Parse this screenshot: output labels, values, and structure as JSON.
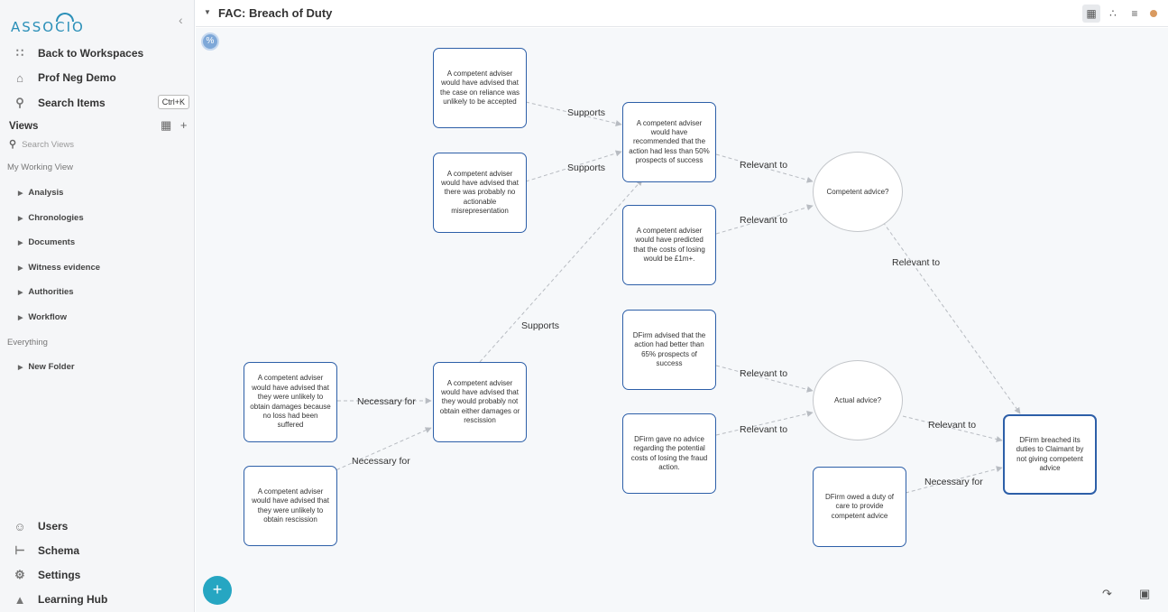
{
  "sidebar": {
    "logo": "ASSOCIO",
    "collapse_icon": "chevron-left-icon",
    "back": "Back to Workspaces",
    "workspace": "Prof Neg Demo",
    "search": "Search Items",
    "search_shortcut": "Ctrl+K",
    "views_title": "Views",
    "views_search_placeholder": "Search Views",
    "my_working_view": "My Working View",
    "folders": [
      "Analysis",
      "Chronologies",
      "Documents",
      "Witness evidence",
      "Authorities",
      "Workflow"
    ],
    "everything": "Everything",
    "new_folder": "New Folder",
    "bottom": [
      "Users",
      "Schema",
      "Settings",
      "Learning Hub"
    ]
  },
  "topbar": {
    "title": "FAC: Breach of Duty",
    "colors": {
      "status_dot": "#d99a60"
    }
  },
  "canvas": {
    "nodes": {
      "n1": "A competent adviser would have advised that the case on reliance was unlikely to be accepted",
      "n2": "A competent adviser would have advised that there was probably no actionable misrepresentation",
      "n3": "A competent adviser would have recommended that the action had less than 50% prospects of success",
      "n4": "A competent adviser would have predicted that the costs of losing would be £1m+.",
      "n5": "DFirm advised that the action had better than 65% prospects of success",
      "n6": "DFirm gave no advice regarding the potential costs of losing the fraud action.",
      "n7": "A competent adviser would have advised that they were unlikely to obtain damages because no loss had been suffered",
      "n8": "A competent adviser would have advised that they would probably not obtain either damages or rescission",
      "n9": "A competent adviser would have advised that they were unlikely to obtain rescission",
      "n10": "DFirm owed a duty of care to provide competent advice",
      "n11": "DFirm breached its duties to Claimant by not giving competent advice",
      "e1": "Competent advice?",
      "e2": "Actual advice?"
    },
    "edges": {
      "supports": "Supports",
      "relevant": "Relevant to",
      "necessary": "Necessary for"
    },
    "colors": {
      "node_border": "#2d5fa8",
      "edge": "#b8bcc2",
      "fab": "#26a6c2"
    }
  }
}
